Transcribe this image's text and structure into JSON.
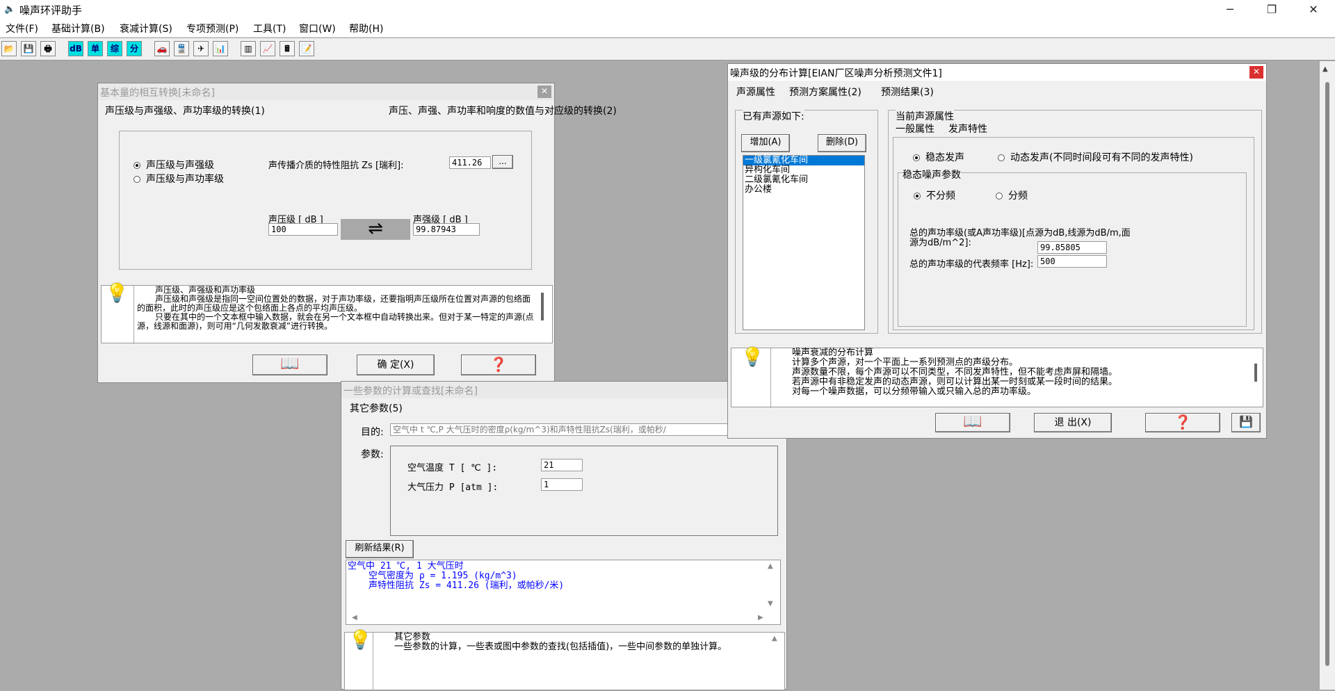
{
  "app": {
    "title": "噪声环评助手",
    "window_controls": {
      "minimize": "─",
      "restore": "❐",
      "close": "✕"
    }
  },
  "menu": [
    "文件(F)",
    "基础计算(B)",
    "衰减计算(S)",
    "专项预测(P)",
    "工具(T)",
    "窗口(W)",
    "帮助(H)"
  ],
  "toolbar": {
    "buttons": [
      {
        "icon": "open-folder-icon",
        "label": "📂"
      },
      {
        "icon": "save-icon",
        "label": "💾"
      },
      {
        "icon": "print-icon",
        "label": "🖶"
      },
      {
        "icon": "db-icon",
        "label": "dB"
      },
      {
        "icon": "single-icon",
        "label": "单"
      },
      {
        "icon": "composite-icon",
        "label": "综"
      },
      {
        "icon": "split-icon",
        "label": "分"
      },
      {
        "icon": "car-icon",
        "label": "🚗"
      },
      {
        "icon": "train-icon",
        "label": "🚆"
      },
      {
        "icon": "plane-icon",
        "label": "✈"
      },
      {
        "icon": "chart-icon",
        "label": "📊"
      },
      {
        "icon": "barcode-icon",
        "label": "▥"
      },
      {
        "icon": "line-chart-icon",
        "label": "📈"
      },
      {
        "icon": "calculator-icon",
        "label": "🖩"
      },
      {
        "icon": "edit-note-icon",
        "label": "📝"
      }
    ]
  },
  "conv_dialog": {
    "title": "基本量的相互转换[未命名]",
    "tab1": "声压级与声强级、声功率级的转换(1)",
    "tab2": "声压、声强、声功率和响度的数值与对应级的转换(2)",
    "radio1": "声压级与声强级",
    "radio2": "声压级与声功率级",
    "impedance_label": "声传播介质的特性阻抗 Zs [瑞利]:",
    "impedance_value": "411.26",
    "browse": "...",
    "spl_label": "声压级 [ dB ]",
    "spl_value": "100",
    "sil_label": "声强级 [ dB ]",
    "sil_value": "99.87943",
    "help_title": "声压级、声强级和声功率级",
    "help_text": "声压级和声强级是指同一空间位置处的数据，对于声功率级，还要指明声压级所在位置对声源的包络面的面积，此时的声压级应是这个包络面上各点的平均声压级。",
    "help_text2": "只要在其中的一个文本框中输入数据，就会在另一个文本框中自动转换出来。但对于某一特定的声源(点源，线源和面源)，则可用“几何发散衰减”进行转换。",
    "ok_label": "确 定(X)"
  },
  "params_dialog": {
    "title": "一些参数的计算或查找[未命名]",
    "tab": "其它参数(5)",
    "purpose_label": "目的:",
    "purpose_value": "空气中 t ℃,P 大气压时的密度ρ(kg/m^3)和声特性阻抗Zs(瑞利，或帕秒/",
    "params_label": "参数:",
    "temp_label": "空气温度 T [ ℃ ]:",
    "temp_value": "21",
    "pressure_label": "大气压力 P [atm ]:",
    "pressure_value": "1",
    "refresh_label": "刷新结果(R)",
    "result_line1": "空气中 21 ℃, 1 大气压时",
    "result_line2": "空气密度为 ρ = 1.195 (kg/m^3)",
    "result_line3": "声特性阻抗 Zs = 411.26 (瑞利，或帕秒/米)",
    "help_title": "其它参数",
    "help_text": "一些参数的计算，一些表或图中参数的查找(包括插值)，一些中间参数的单独计算。"
  },
  "dist_dialog": {
    "title": "噪声级的分布计算[EIAN厂区噪声分析预测文件1]",
    "tab1": "声源属性",
    "tab2": "预测方案属性(2)",
    "tab3": "预测结果(3)",
    "sources_group": "已有声源如下:",
    "add_label": "增加(A)",
    "delete_label": "删除(D)",
    "sources": [
      "一级氯氰化车间",
      "异构化车间",
      "二级氯氰化车间",
      "办公楼"
    ],
    "current_group": "当前声源属性",
    "subtab1": "一般属性",
    "subtab2": "发声特性",
    "steady_label": "稳态发声",
    "dynamic_label": "动态发声(不同时间段可有不同的发声特性)",
    "steady_params": "稳态噪声参数",
    "nofreq_label": "不分频",
    "freq_label": "分频",
    "total_label1": "总的声功率级(或A声功率级)[点源为dB,线源为dB/m,面",
    "total_label2": "源为dB/m^2]:",
    "total_value": "99.85805",
    "freq_rep_label": "总的声功率级的代表频率  [Hz]:",
    "freq_rep_value": "500",
    "help_title": "噪声衰减的分布计算",
    "help_text1": "计算多个声源，对一个平面上一系列预测点的声级分布。",
    "help_text2": "声源数量不限，每个声源可以不同类型，不同发声特性，但不能考虑声屏和隔墙。",
    "help_text3": "若声源中有非稳定发声的动态声源，则可以计算出某一时刻或某一段时间的结果。",
    "help_text4": "对每一个噪声数据，可以分频带输入或只输入总的声功率级。",
    "exit_label": "退 出(X)"
  }
}
